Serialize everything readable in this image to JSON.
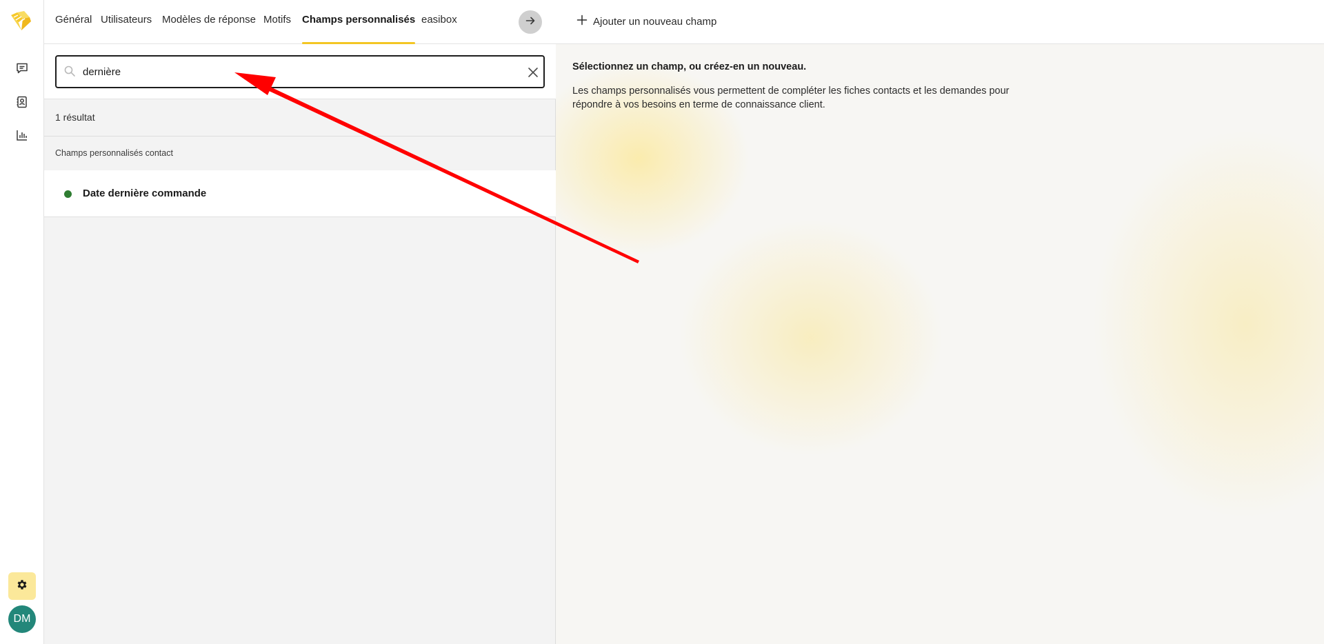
{
  "rail": {
    "logo": "hearts-logo-icon",
    "nav": [
      {
        "name": "messages",
        "icon": "chat-bubble-icon"
      },
      {
        "name": "contacts",
        "icon": "contact-book-icon"
      },
      {
        "name": "statistics",
        "icon": "bar-chart-icon"
      }
    ],
    "settings_icon": "gear-icon",
    "avatar_initials": "DM"
  },
  "tabs": [
    {
      "label": "Général",
      "active": false
    },
    {
      "label": "Utilisateurs",
      "active": false
    },
    {
      "label": "Modèles de réponse",
      "active": false
    },
    {
      "label": "Motifs",
      "active": false
    },
    {
      "label": "Champs personnalisés",
      "active": true
    },
    {
      "label": "easibox",
      "active": false
    }
  ],
  "search": {
    "value": "dernière",
    "placeholder": ""
  },
  "results": {
    "count_label": "1 résultat",
    "section_title": "Champs personnalisés contact",
    "items": [
      {
        "label": "Date dernière commande",
        "status_color": "#2f7d32"
      }
    ]
  },
  "right_pane": {
    "add_button_label": "Ajouter un nouveau champ",
    "empty_title": "Sélectionnez un champ, ou créez-en un nouveau.",
    "empty_description": "Les champs personnalisés vous permettent de compléter les fiches contacts et les demandes pour répondre à vos besoins en terme de connaissance client."
  },
  "colors": {
    "accent": "#f3c623",
    "settings_bg": "#fbe89a",
    "avatar_bg": "#23877a",
    "annotation": "#ff0000"
  }
}
